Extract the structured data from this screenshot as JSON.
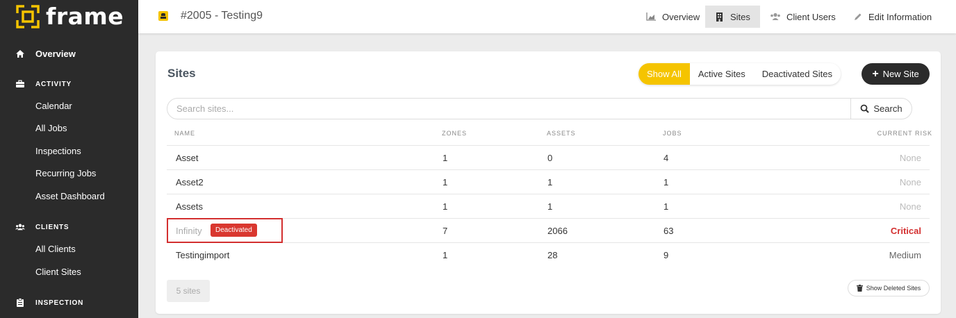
{
  "app": {
    "logo_text": "frame"
  },
  "sidebar": {
    "overview": "Overview",
    "sections": [
      {
        "title": "ACTIVITY",
        "items": [
          "Calendar",
          "All Jobs",
          "Inspections",
          "Recurring Jobs",
          "Asset Dashboard"
        ]
      },
      {
        "title": "CLIENTS",
        "items": [
          "All Clients",
          "Client Sites"
        ]
      },
      {
        "title": "INSPECTION",
        "items": []
      }
    ]
  },
  "header": {
    "title": "#2005 - Testing9",
    "nav": [
      "Overview",
      "Sites",
      "Client Users",
      "Edit Information"
    ],
    "active": "Sites"
  },
  "card": {
    "title": "Sites",
    "filters": [
      "Show All",
      "Active Sites",
      "Deactivated Sites"
    ],
    "active_filter": "Show All",
    "new_button": "New Site",
    "search": {
      "placeholder": "Search sites...",
      "button": "Search"
    },
    "columns": [
      "NAME",
      "ZONES",
      "ASSETS",
      "JOBS",
      "CURRENT RISK"
    ],
    "rows": [
      {
        "name": "Asset",
        "zones": "1",
        "assets": "0",
        "jobs": "4",
        "risk": "None"
      },
      {
        "name": "Asset2",
        "zones": "1",
        "assets": "1",
        "jobs": "1",
        "risk": "None"
      },
      {
        "name": "Assets",
        "zones": "1",
        "assets": "1",
        "jobs": "1",
        "risk": "None"
      },
      {
        "name": "Infinity",
        "badge": "Deactivated",
        "zones": "7",
        "assets": "2066",
        "jobs": "63",
        "risk": "Critical"
      },
      {
        "name": "Testingimport",
        "zones": "1",
        "assets": "28",
        "jobs": "9",
        "risk": "Medium"
      }
    ],
    "count": "5 sites",
    "show_deleted": "Show Deleted Sites"
  },
  "colors": {
    "accent": "#f5c400",
    "sidebar": "#2b2b2b",
    "critical": "#d32f2f"
  }
}
